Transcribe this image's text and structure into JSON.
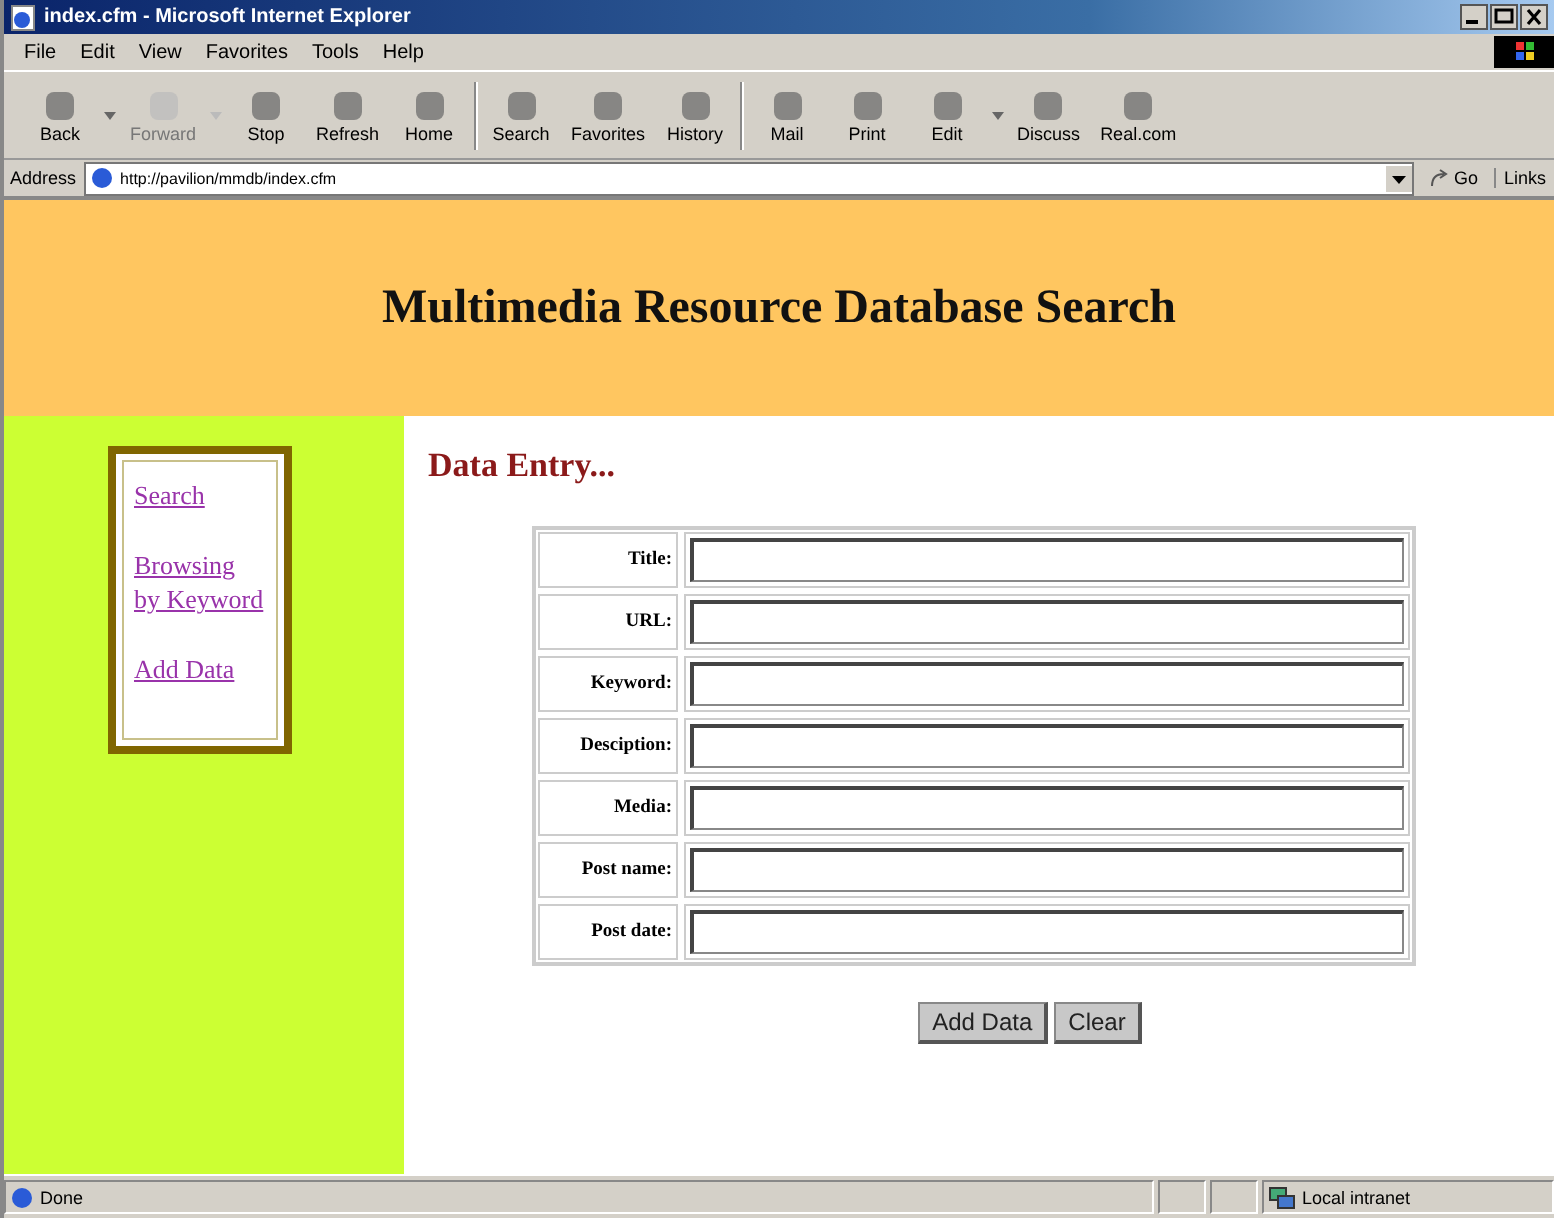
{
  "window": {
    "title": "index.cfm - Microsoft Internet Explorer"
  },
  "menu": [
    "File",
    "Edit",
    "View",
    "Favorites",
    "Tools",
    "Help"
  ],
  "toolbar": [
    {
      "label": "Back",
      "disabled": false,
      "dropdown": true
    },
    {
      "label": "Forward",
      "disabled": true,
      "dropdown": true
    },
    {
      "label": "Stop",
      "disabled": false,
      "dropdown": false
    },
    {
      "label": "Refresh",
      "disabled": false,
      "dropdown": false
    },
    {
      "label": "Home",
      "disabled": false,
      "dropdown": false
    },
    {
      "label": "Search",
      "disabled": false,
      "dropdown": false
    },
    {
      "label": "Favorites",
      "disabled": false,
      "dropdown": false
    },
    {
      "label": "History",
      "disabled": false,
      "dropdown": false
    },
    {
      "label": "Mail",
      "disabled": false,
      "dropdown": false
    },
    {
      "label": "Print",
      "disabled": false,
      "dropdown": false
    },
    {
      "label": "Edit",
      "disabled": false,
      "dropdown": true
    },
    {
      "label": "Discuss",
      "disabled": false,
      "dropdown": false
    },
    {
      "label": "Real.com",
      "disabled": false,
      "dropdown": false
    }
  ],
  "address": {
    "label": "Address",
    "value": "http://pavilion/mmdb/index.cfm",
    "go": "Go",
    "links": "Links"
  },
  "page": {
    "heading": "Multimedia Resource Database Search",
    "nav": [
      "Search",
      "Browsing by Keyword",
      "Add Data"
    ],
    "section_title": "Data Entry...",
    "fields": [
      {
        "label": "Title:"
      },
      {
        "label": "URL:"
      },
      {
        "label": "Keyword:"
      },
      {
        "label": "Desciption:"
      },
      {
        "label": "Media:"
      },
      {
        "label": "Post name:"
      },
      {
        "label": "Post date:"
      }
    ],
    "buttons": [
      "Add Data",
      "Clear"
    ]
  },
  "status_bar": {
    "text": "Done",
    "zone": "Local intranet"
  }
}
